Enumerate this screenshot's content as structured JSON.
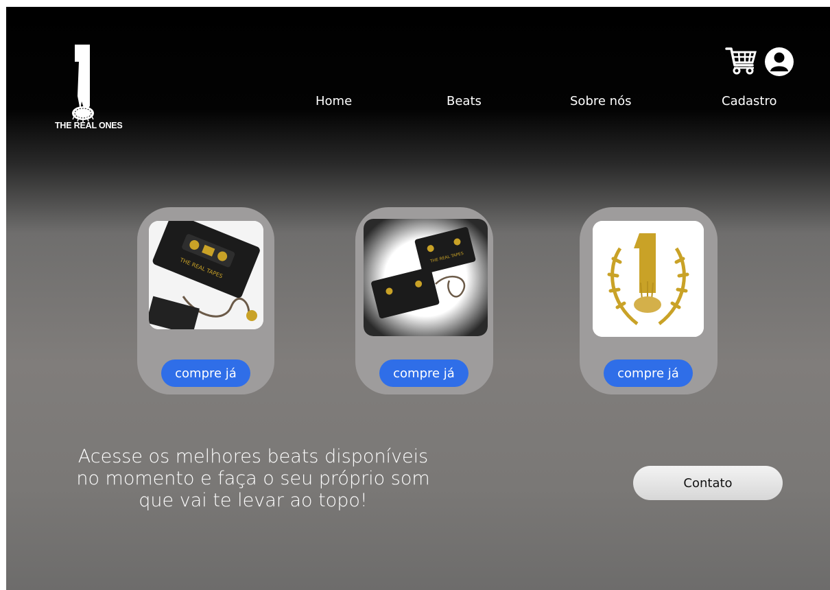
{
  "brand": {
    "name": "THE REAL ONES",
    "logo_icon": "number-one-roots-logo"
  },
  "nav": {
    "items": [
      {
        "label": "Home"
      },
      {
        "label": "Beats"
      },
      {
        "label": "Sobre nós"
      },
      {
        "label": "Cadastro"
      }
    ]
  },
  "header_icons": {
    "cart": "shopping-cart-icon",
    "user": "user-profile-icon"
  },
  "products": [
    {
      "art": "black cassette tapes cover",
      "image_text": "THE REAL TAPES",
      "button_label": "compre já"
    },
    {
      "art": "black cassette tapes on white background",
      "image_text": "THE REAL TAPES",
      "button_label": "compre já"
    },
    {
      "art": "gold number one laurel logo",
      "button_label": "compre já"
    }
  ],
  "tagline": {
    "lines": [
      "Acesse os melhores beats disponíveis",
      "no momento e faça o seu próprio som",
      "que vai te levar ao topo!"
    ]
  },
  "contact": {
    "label": "Contato"
  },
  "colors": {
    "button_blue": "#2f6ee8",
    "card_gray": "#9e9c9c",
    "gold": "#c9a227"
  }
}
